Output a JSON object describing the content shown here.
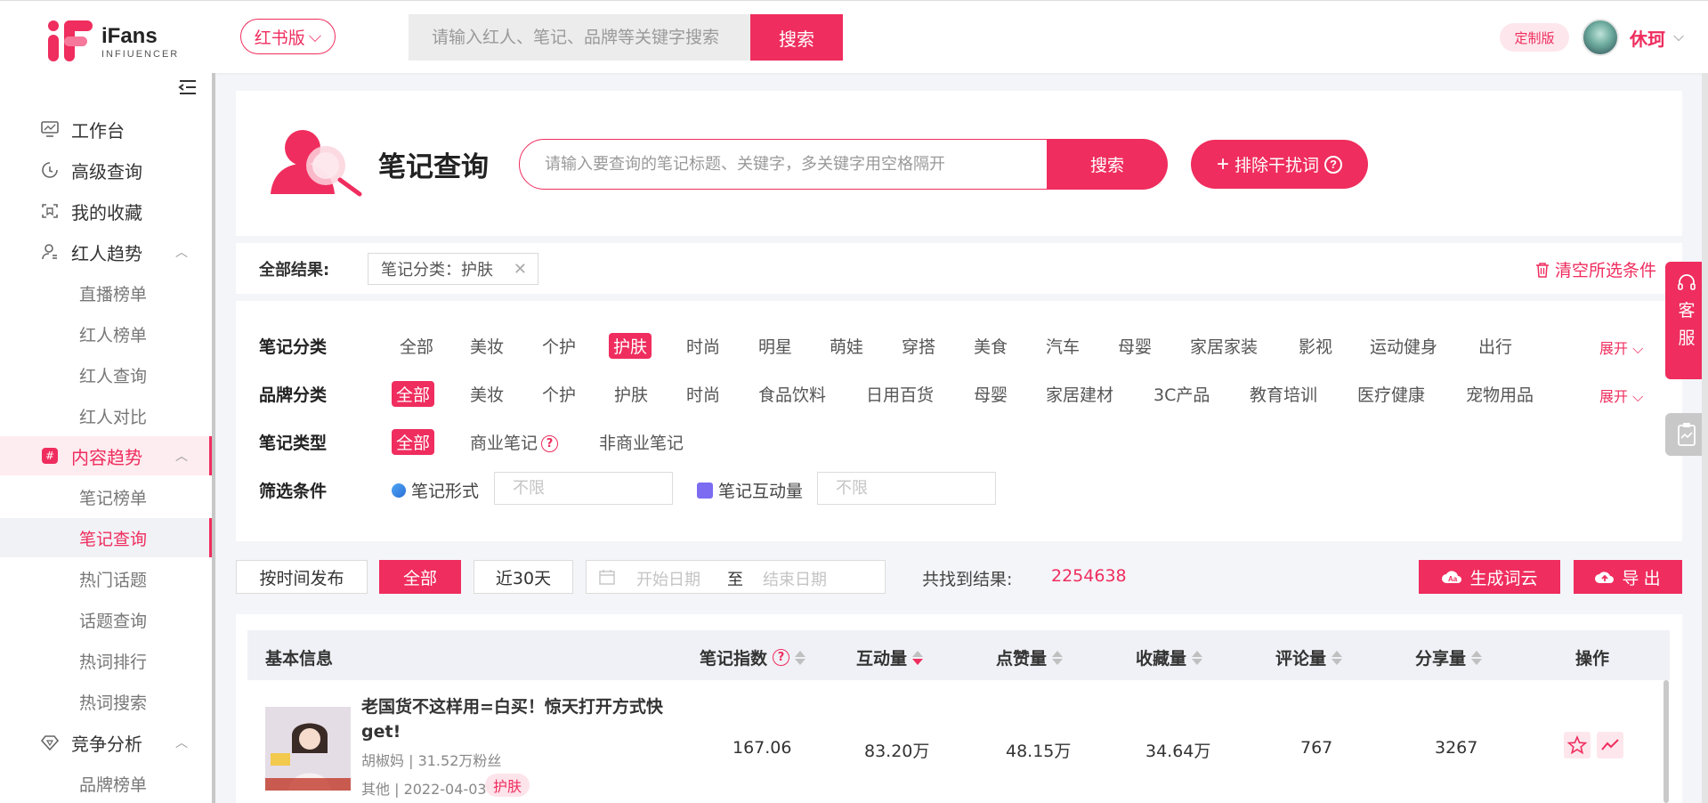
{
  "brand": {
    "name": "iFans",
    "tagline": "INFIUENCER"
  },
  "header": {
    "edition_label": "红书版",
    "search_placeholder": "请输入红人、笔记、品牌等关键字搜索",
    "search_button": "搜索",
    "custom_badge": "定制版",
    "user_name": "休珂"
  },
  "sidebar": {
    "items": [
      {
        "label": "工作台",
        "icon": "monitor-icon"
      },
      {
        "label": "高级查询",
        "icon": "clock-search-icon"
      },
      {
        "label": "我的收藏",
        "icon": "bookmark-icon"
      },
      {
        "label": "红人趋势",
        "icon": "user-icon"
      },
      {
        "label": "直播榜单"
      },
      {
        "label": "红人榜单"
      },
      {
        "label": "红人查询"
      },
      {
        "label": "红人对比"
      },
      {
        "label": "内容趋势",
        "icon": "hash-icon"
      },
      {
        "label": "笔记榜单"
      },
      {
        "label": "笔记查询"
      },
      {
        "label": "热门话题"
      },
      {
        "label": "话题查询"
      },
      {
        "label": "热词排行"
      },
      {
        "label": "热词搜索"
      },
      {
        "label": "竞争分析",
        "icon": "diamond-icon"
      },
      {
        "label": "品牌榜单"
      }
    ]
  },
  "hero": {
    "title": "笔记查询",
    "search_placeholder": "请输入要查询的笔记标题、关键字，多关键字用空格隔开",
    "search_button": "搜索",
    "exclude_button": "排除干扰词"
  },
  "results_bar": {
    "label": "全部结果:",
    "tag": "笔记分类：护肤",
    "clear": "清空所选条件"
  },
  "filters": {
    "note_category": {
      "label": "笔记分类",
      "options": [
        "全部",
        "美妆",
        "个护",
        "护肤",
        "时尚",
        "明星",
        "萌娃",
        "穿搭",
        "美食",
        "汽车",
        "母婴",
        "家居家装",
        "影视",
        "运动健身",
        "出行"
      ],
      "selected": "护肤",
      "expand": "展开"
    },
    "brand_category": {
      "label": "品牌分类",
      "options": [
        "全部",
        "美妆",
        "个护",
        "护肤",
        "时尚",
        "食品饮料",
        "日用百货",
        "母婴",
        "家居建材",
        "3C产品",
        "教育培训",
        "医疗健康",
        "宠物用品"
      ],
      "selected": "全部",
      "expand": "展开"
    },
    "note_type": {
      "label": "笔记类型",
      "options": [
        "全部",
        "商业笔记",
        "非商业笔记"
      ],
      "selected": "全部"
    },
    "conditions": {
      "label": "筛选条件",
      "form_label": "笔记形式",
      "form_placeholder": "不限",
      "interaction_label": "笔记互动量",
      "interaction_placeholder": "不限"
    }
  },
  "toolbar": {
    "sort_time": "按时间发布",
    "all": "全部",
    "last30": "近30天",
    "start_placeholder": "开始日期",
    "to": "至",
    "end_placeholder": "结束日期",
    "found_label": "共找到结果:",
    "found_count": "2254638",
    "wordcloud": "生成词云",
    "export": "导 出"
  },
  "table": {
    "headers": [
      "基本信息",
      "笔记指数",
      "互动量",
      "点赞量",
      "收藏量",
      "评论量",
      "分享量",
      "操作"
    ],
    "rows": [
      {
        "title": "老国货不这样用=白买！惊天打开方式快get!",
        "author": "胡椒妈 | 31.52万粉丝",
        "meta": "其他 | 2022-04-03",
        "tag": "护肤",
        "index": "167.06",
        "interactions": "83.20万",
        "likes": "48.15万",
        "favorites": "34.64万",
        "comments": "767",
        "shares": "3267"
      }
    ]
  },
  "float": {
    "service": [
      "客",
      "服"
    ]
  },
  "colors": {
    "accent": "#ef2d5e"
  }
}
